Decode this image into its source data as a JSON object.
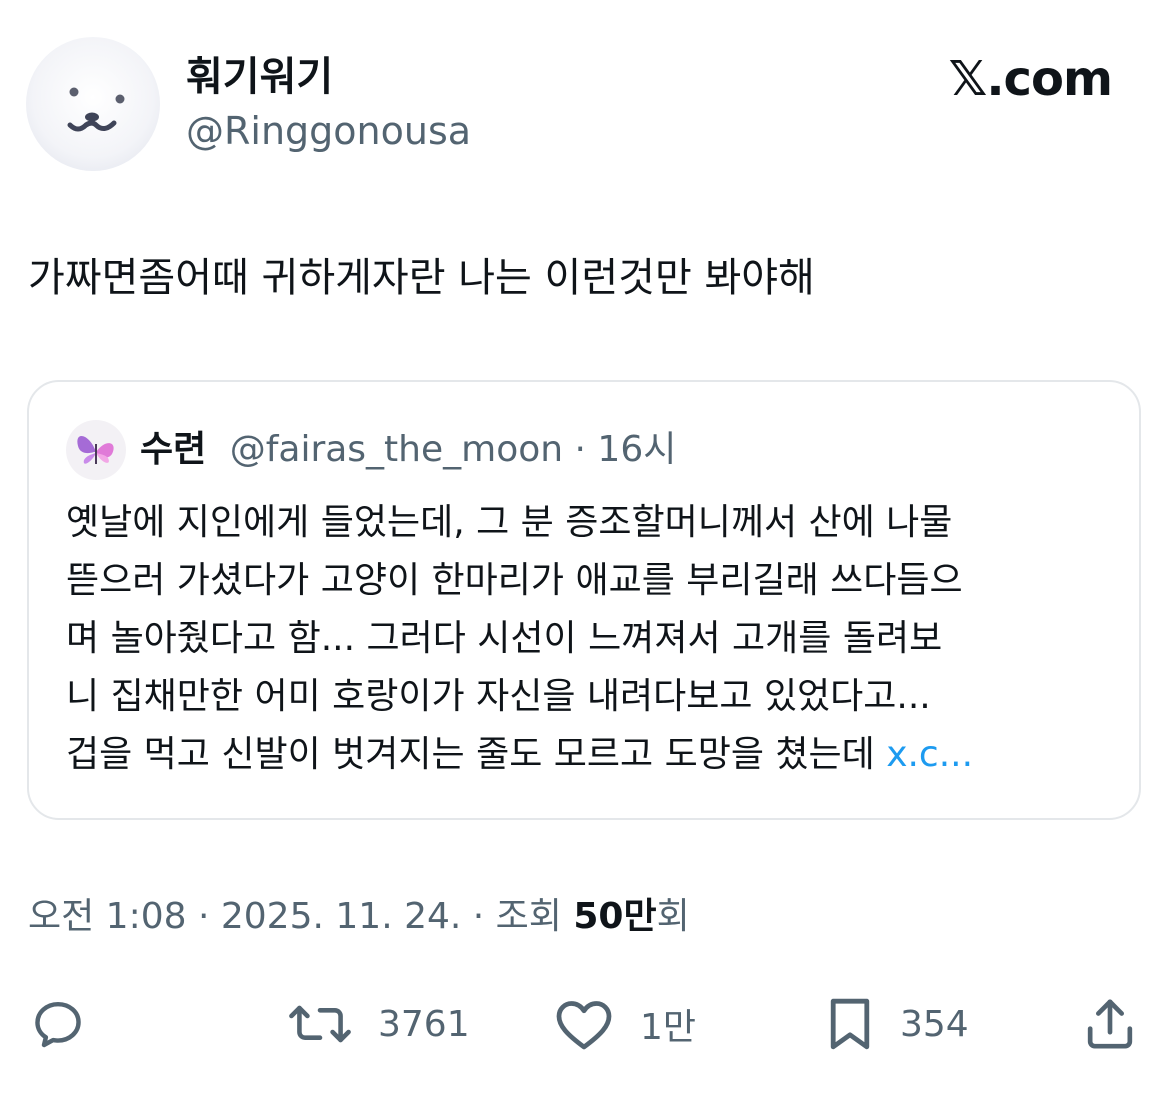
{
  "author": {
    "display_name": "훠기워기",
    "handle": "@Ringgonousa"
  },
  "brand": "𝕏.com",
  "tweet_text": "가짜면좀어때 귀하게자란 나는 이런것만 봐야해",
  "quoted": {
    "name": "수련",
    "handle": "@fairas_the_moon",
    "separator": " · ",
    "time": "16시",
    "lines": [
      "옛날에 지인에게 들었는데, 그 분 증조할머니께서 산에 나물",
      "뜯으러 가셨다가 고양이 한마리가 애교를 부리길래 쓰다듬으",
      "며 놀아줬다고 함... 그러다 시선이 느껴져서 고개를 돌려보",
      "니 집채만한 어미 호랑이가 자신을 내려다보고 있었다고...",
      "겁을 먹고 신발이 벗겨지는 줄도 모르고 도망을 쳤는데 "
    ],
    "link_text": "x.c...",
    "link_color": "#1d9bf0"
  },
  "meta": {
    "time": "오전 1:08",
    "date": "2025. 11. 24.",
    "views_prefix": "조회 ",
    "views_count": "50만",
    "views_suffix": "회",
    "separator": " · "
  },
  "actions": {
    "reply_icon": "reply-icon",
    "retweet_count": "3761",
    "like_count": "1만",
    "bookmark_count": "354",
    "share_icon": "share-icon"
  },
  "colors": {
    "text": "#0f1419",
    "secondary": "#536471",
    "border": "#e4e7ea",
    "accent": "#1d9bf0"
  }
}
